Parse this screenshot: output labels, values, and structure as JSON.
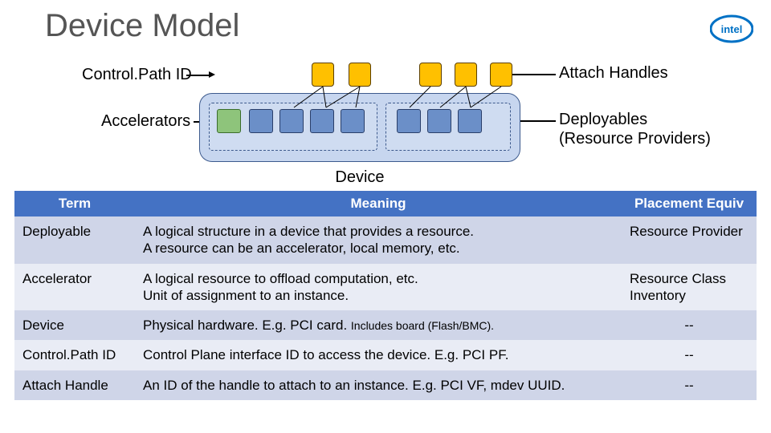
{
  "title": "Device Model",
  "logo_alt": "intel",
  "labels": {
    "control_path": "Control.Path ID",
    "accelerators": "Accelerators",
    "attach_handles": "Attach Handles",
    "deployables": "Deployables",
    "deployables2": "(Resource Providers)",
    "device": "Device"
  },
  "table": {
    "headers": {
      "term": "Term",
      "meaning": "Meaning",
      "placement": "Placement Equiv"
    },
    "rows": [
      {
        "term": "Deployable",
        "meaning": "A logical structure in a device that provides a resource.\nA resource can be an accelerator, local memory, etc.",
        "placement": "Resource Provider",
        "placement_align": "left"
      },
      {
        "term": "Accelerator",
        "meaning": "A logical resource to offload computation, etc.\nUnit of assignment to an instance.",
        "placement": "Resource Class\nInventory",
        "placement_align": "left"
      },
      {
        "term": "Device",
        "meaning": "Physical hardware. E.g. PCI card. ",
        "meaning_small": "Includes board (Flash/BMC).",
        "placement": "--"
      },
      {
        "term": "Control.Path ID",
        "meaning": "Control Plane interface ID to access the device. E.g. PCI PF.",
        "placement": "--"
      },
      {
        "term": "Attach Handle",
        "meaning": "An ID of the handle to attach to an instance. E.g. PCI VF, mdev UUID.",
        "placement": "--"
      }
    ]
  }
}
